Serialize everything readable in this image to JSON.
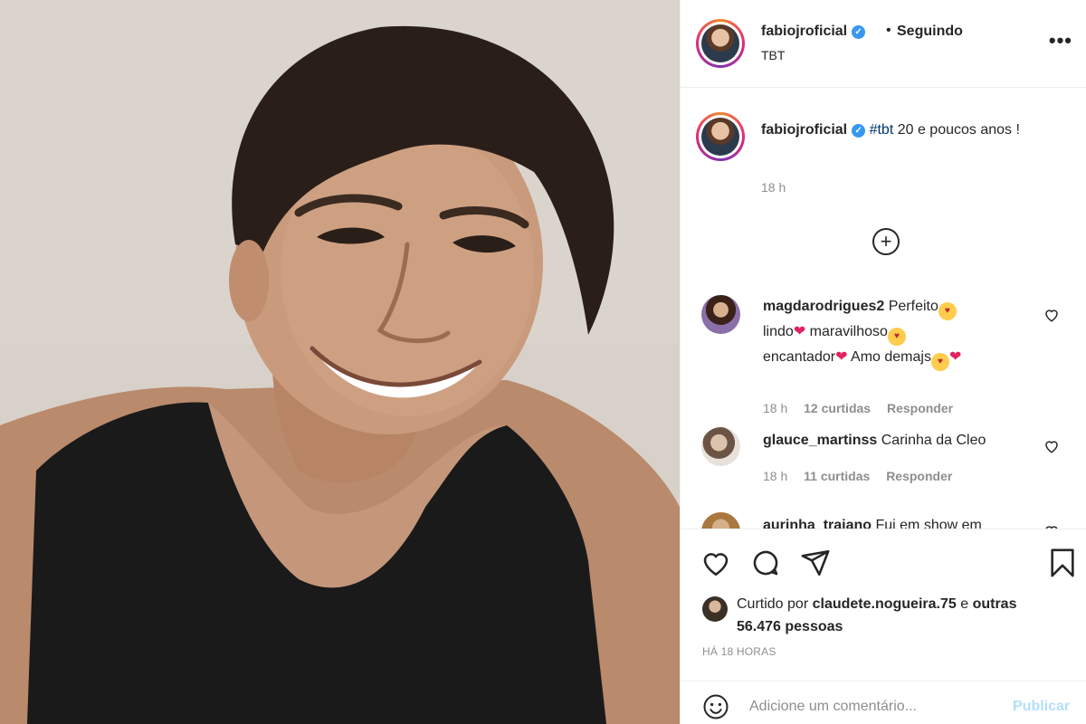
{
  "header": {
    "username": "fabiojroficial",
    "separator": "•",
    "follow_label": "Seguindo",
    "subtitle": "TBT",
    "more_icon": "more-options-icon",
    "more_label": "•••"
  },
  "caption": {
    "username": "fabiojroficial",
    "hashtag": "#tbt",
    "text": " 20 e poucos anos !",
    "time": "18 h"
  },
  "load_more": {
    "icon": "plus-circle-icon",
    "label": "+"
  },
  "comments": [
    {
      "username": "magdarodrigues2",
      "segments": [
        "Perfeito",
        "lindo",
        "maravilhoso",
        "encantador",
        "Amo demajs"
      ],
      "time": "18 h",
      "likes": "12 curtidas",
      "reply": "Responder"
    },
    {
      "username": "glauce_martinss",
      "text": "Carinha da Cleo",
      "time": "18 h",
      "likes": "11 curtidas",
      "reply": "Responder"
    },
    {
      "username": "aurinha_trajano",
      "text": "Fui em show em"
    }
  ],
  "actions": {
    "like_icon": "heart-icon",
    "comment_icon": "comment-icon",
    "share_icon": "share-icon",
    "save_icon": "bookmark-icon"
  },
  "likes": {
    "prefix": "Curtido por ",
    "user": "claudete.nogueira.75",
    "middle": " e ",
    "others": "outras 56.476 pessoas"
  },
  "posted_ago": "HÁ 18 HORAS",
  "add_comment": {
    "placeholder": "Adicione um comentário...",
    "publish_label": "Publicar",
    "emoji_icon": "smiley-icon"
  },
  "colors": {
    "text": "#262626",
    "muted": "#8e8e8e",
    "link": "#00376b",
    "verified": "#3897f0",
    "publish_disabled": "#b2dffc",
    "heart": "#e0245e"
  }
}
